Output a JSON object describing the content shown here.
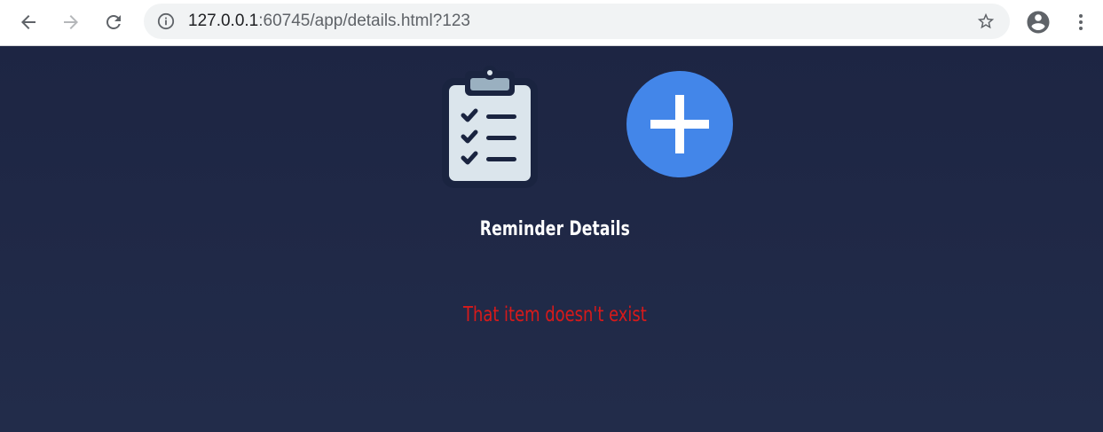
{
  "browser": {
    "address_host": "127.0.0.1",
    "address_rest": ":60745/app/details.html?123"
  },
  "icons": {
    "back": "back-arrow-icon",
    "forward": "forward-arrow-icon",
    "reload": "reload-icon",
    "site_info": "info-icon",
    "bookmark": "star-icon",
    "profile": "account-icon",
    "menu": "more-vert-icon",
    "clipboard": "clipboard-checklist-icon",
    "add": "plus-icon"
  },
  "colors": {
    "background": "#1d2543",
    "add_button": "#4386e9",
    "title": "#ffffff",
    "error": "#d81a1a"
  },
  "page": {
    "title": "Reminder Details",
    "error_message": "That item doesn't exist"
  }
}
